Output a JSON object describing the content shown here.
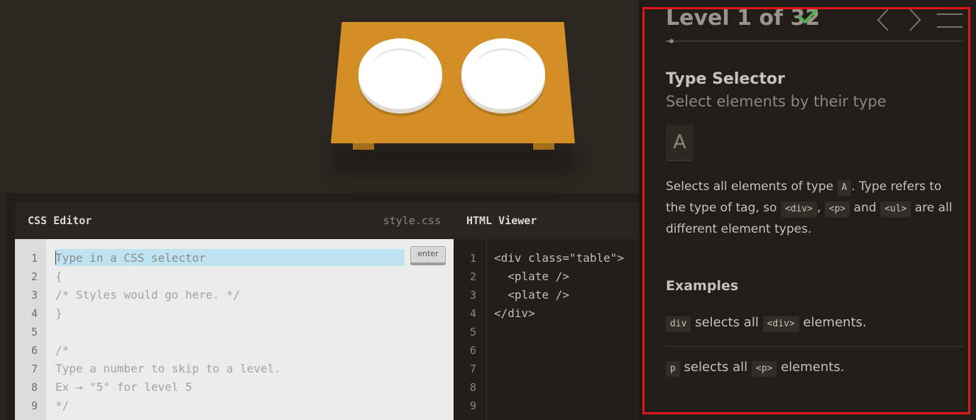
{
  "css_editor": {
    "title": "CSS Editor",
    "filename": "style.css",
    "placeholder": "Type in a CSS selector",
    "enter_label": "enter",
    "line_numbers": [
      "1",
      "2",
      "3",
      "4",
      "5",
      "6",
      "7",
      "8",
      "9"
    ],
    "lines": [
      "{",
      "/* Styles would go here. */",
      "}",
      "",
      "/*",
      "Type a number to skip to a level.",
      "Ex → \"5\" for level 5",
      "*/"
    ]
  },
  "html_viewer": {
    "title": "HTML Viewer",
    "line_numbers": [
      "1",
      "2",
      "3",
      "4",
      "5",
      "6",
      "7",
      "8",
      "9"
    ],
    "lines": [
      "<div class=\"table\">",
      "  <plate />",
      "  <plate />",
      "</div>"
    ]
  },
  "sidebar": {
    "level_title": "Level 1 of 32",
    "level_current": 1,
    "level_total": 32,
    "completed": true,
    "selector_name": "Type Selector",
    "selector_title": "Select elements by their type",
    "syntax": "A",
    "description": {
      "p1": "Selects all elements of type ",
      "tag_a": "A",
      "p2": ". Type refers to the type of tag, so ",
      "tag_div": "<div>",
      "comma": ", ",
      "tag_p": "<p>",
      "and": " and ",
      "tag_ul": "<ul>",
      "p3": " are all different element types."
    },
    "examples_title": "Examples",
    "examples": [
      {
        "code": "div",
        "mid": " selects all ",
        "tag": "<div>",
        "end": " elements."
      },
      {
        "code": "p",
        "mid": " selects all ",
        "tag": "<p>",
        "end": " elements."
      }
    ]
  },
  "colors": {
    "accent_check": "#4caf50",
    "table": "#d38f26",
    "highlight": "#e3151a"
  },
  "icons": [
    "check-icon",
    "chevron-left-icon",
    "chevron-right-icon",
    "menu-icon"
  ]
}
